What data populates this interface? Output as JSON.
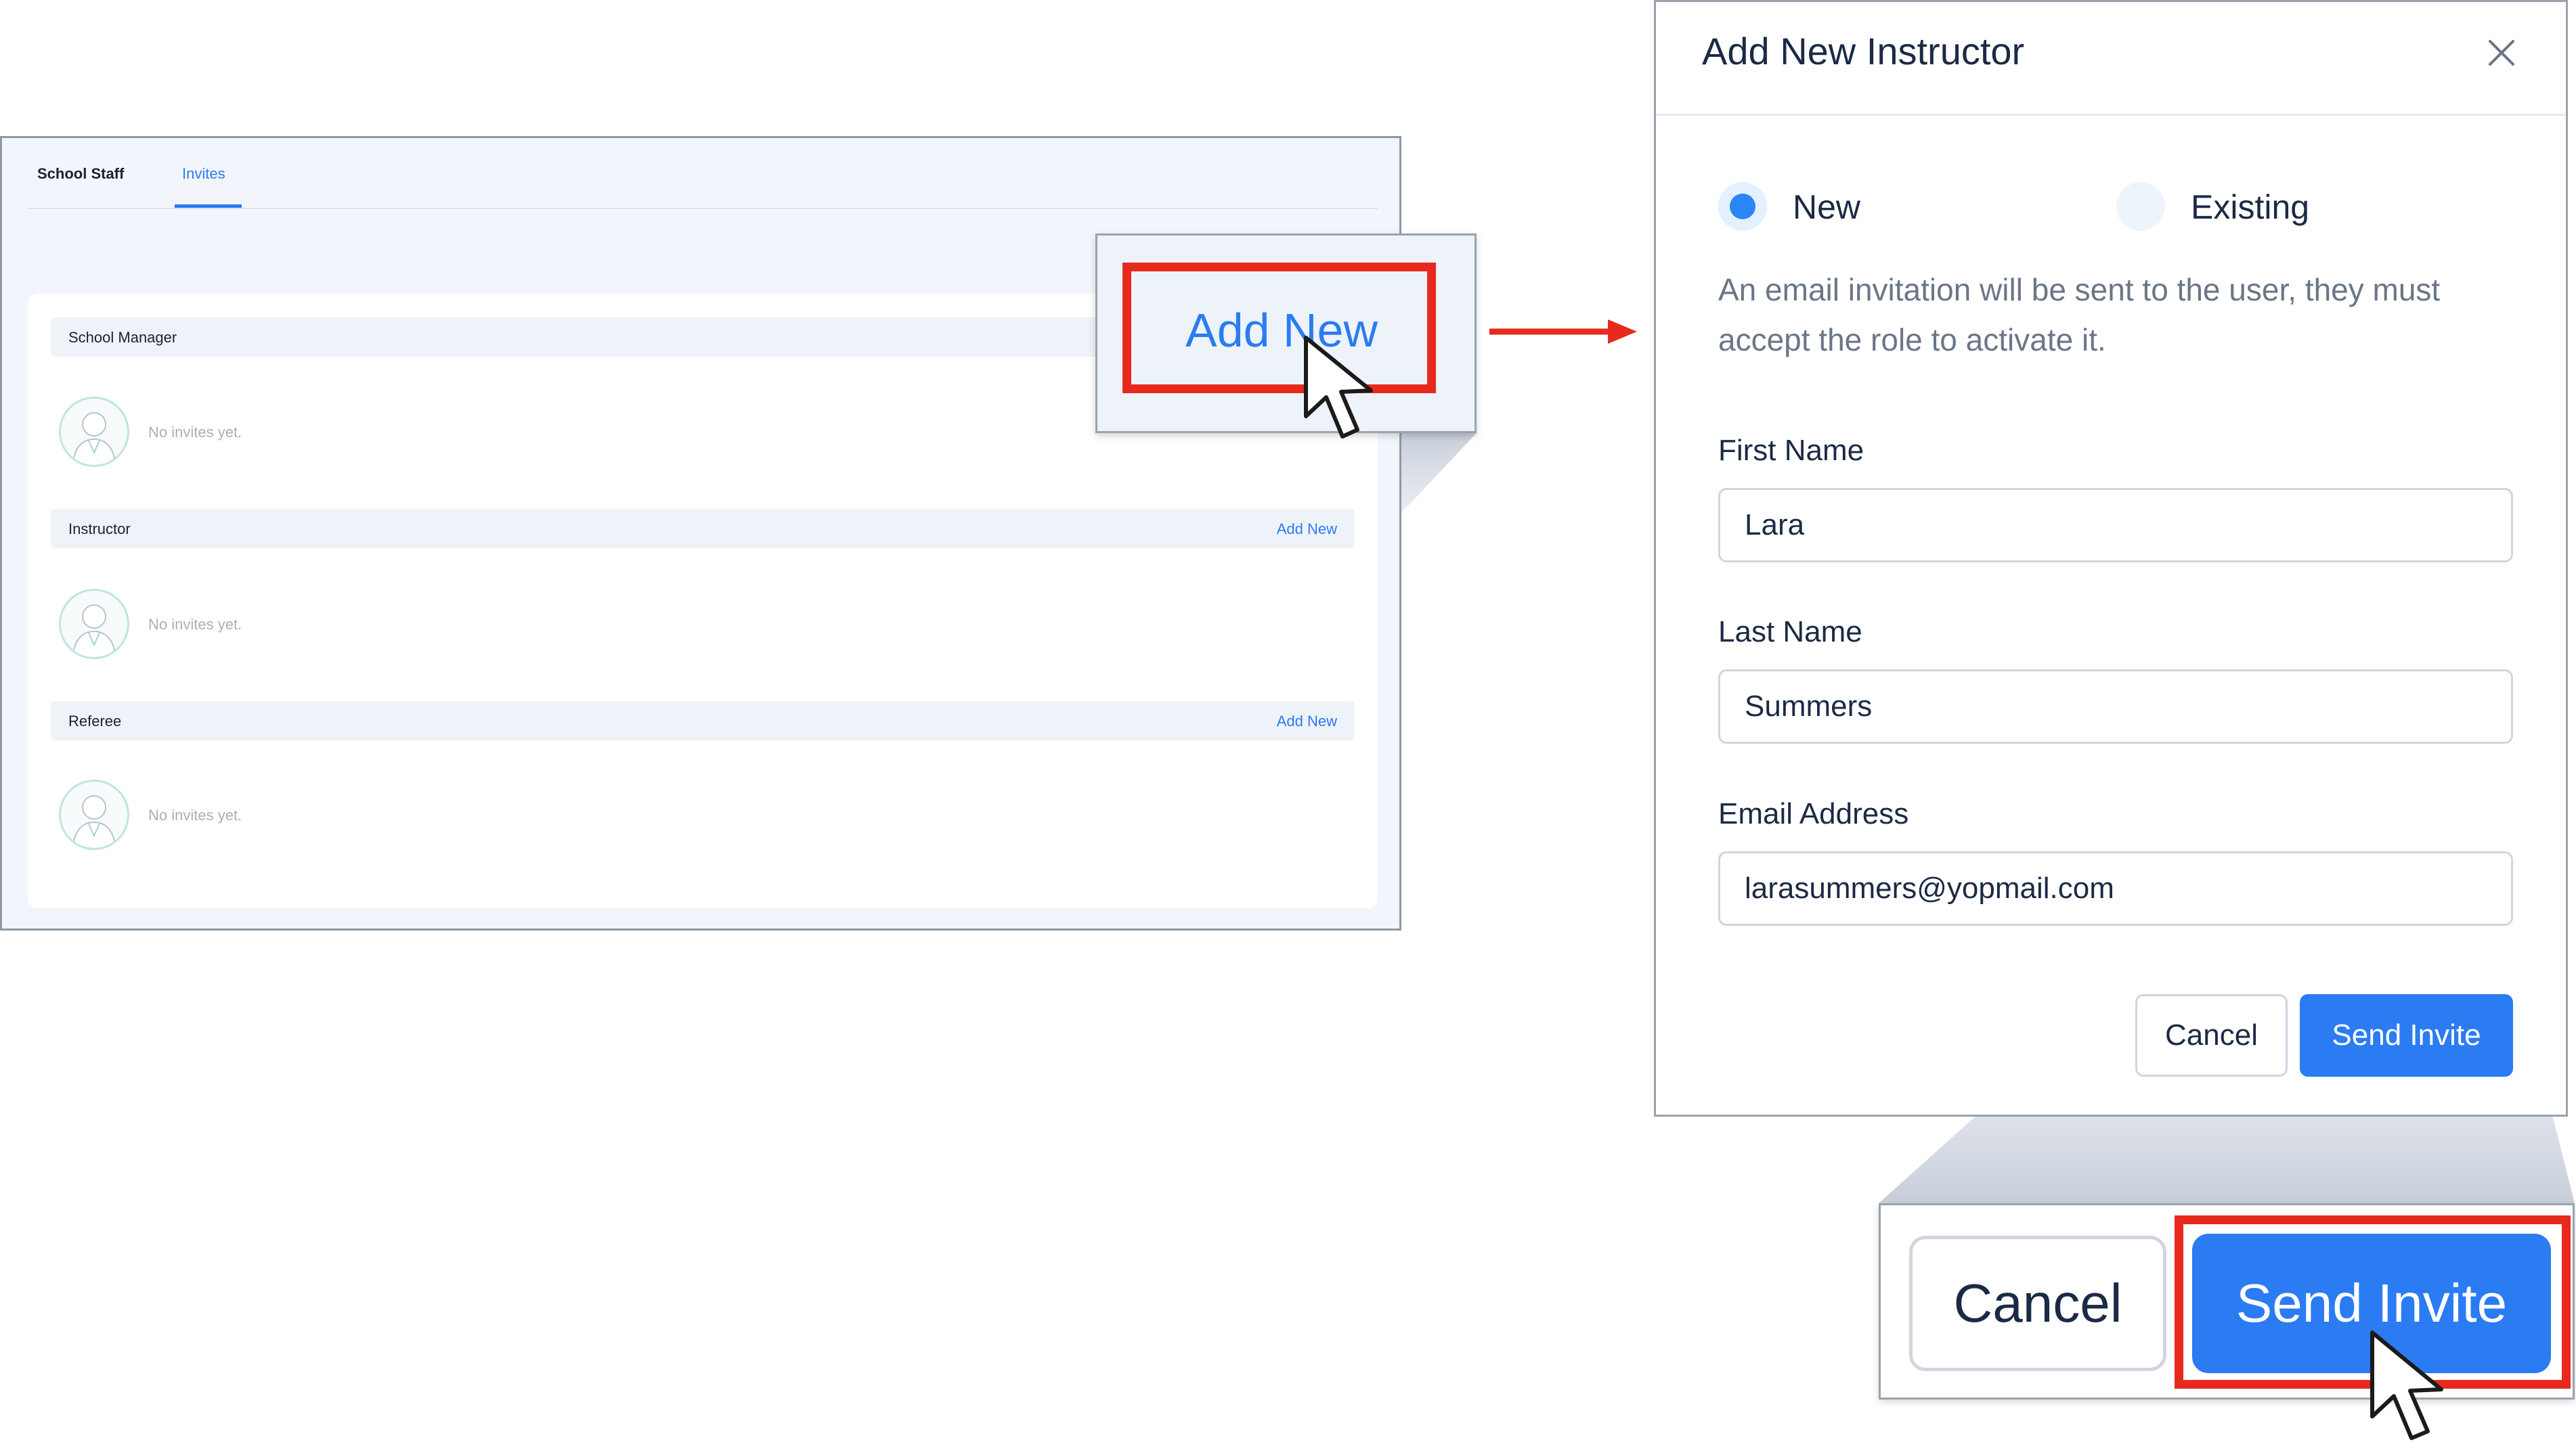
{
  "left_panel": {
    "tabs": [
      {
        "label": "School Staff"
      },
      {
        "label": "Invites"
      }
    ],
    "sections": [
      {
        "label": "School Manager",
        "add_label": "",
        "empty_text": "No invites yet."
      },
      {
        "label": "Instructor",
        "add_label": "Add New",
        "empty_text": "No invites yet."
      },
      {
        "label": "Referee",
        "add_label": "Add New",
        "empty_text": "No invites yet."
      }
    ]
  },
  "zoom_add": {
    "label": "Add New"
  },
  "modal": {
    "title": "Add New Instructor",
    "radio_new_label": "New",
    "radio_existing_label": "Existing",
    "selected": "New",
    "info_text": "An email invitation will be sent to the user, they must accept the role to activate it.",
    "fields": {
      "first_name": {
        "label": "First Name",
        "value": "Lara"
      },
      "last_name": {
        "label": "Last Name",
        "value": "Summers"
      },
      "email": {
        "label": "Email Address",
        "value": "larasummers@yopmail.com"
      }
    },
    "cancel_label": "Cancel",
    "send_label": "Send Invite"
  },
  "zoom_buttons": {
    "cancel_label": "Cancel",
    "send_label": "Send Invite"
  },
  "colors": {
    "accent": "#2b7bf3",
    "highlight": "#e8291d",
    "text_dark": "#1b2a45",
    "text_muted": "#6a7687"
  },
  "icons": {
    "close": "close-icon",
    "cursor": "mouse-pointer-icon",
    "avatar": "user-avatar-icon",
    "arrow": "arrow-right-icon"
  }
}
